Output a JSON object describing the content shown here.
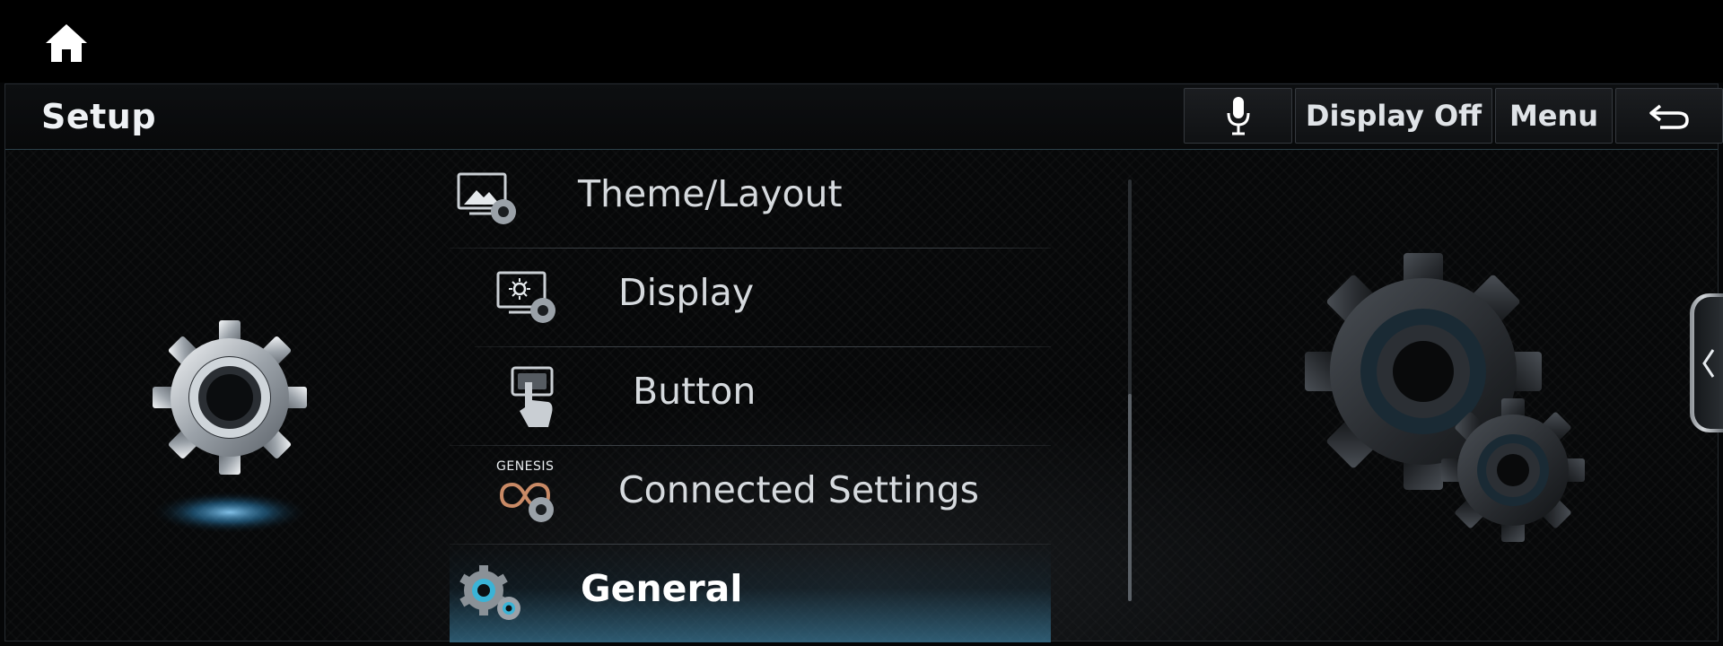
{
  "header": {
    "title": "Setup",
    "buttons": {
      "voice_icon": "microphone-icon",
      "display_off_label": "Display Off",
      "menu_label": "Menu",
      "back_icon": "back-arrow-icon"
    }
  },
  "topbar": {
    "home_icon": "home-icon"
  },
  "list": {
    "items": [
      {
        "label": "Theme/Layout",
        "icon": "theme-layout-icon"
      },
      {
        "label": "Display",
        "icon": "display-settings-icon"
      },
      {
        "label": "Button",
        "icon": "button-press-icon"
      },
      {
        "label": "Connected Settings",
        "icon": "genesis-connected-icon",
        "icon_text": "GENESIS"
      },
      {
        "label": "General",
        "icon": "general-gears-icon",
        "selected": true
      }
    ]
  },
  "decor": {
    "left_icon": "setup-gear-icon",
    "right_icon": "large-gears-icon"
  },
  "side_tab_icon": "chevron-left-icon",
  "colors": {
    "accent": "#4aa8d8",
    "background": "#050607",
    "text": "#d8dde2"
  }
}
